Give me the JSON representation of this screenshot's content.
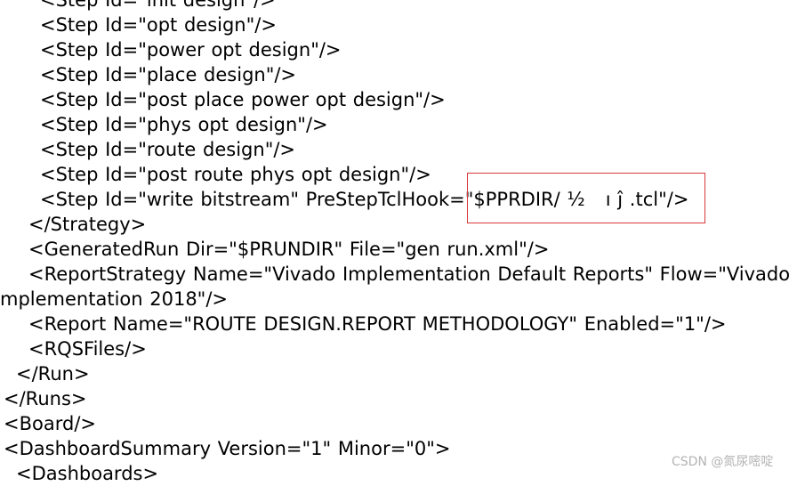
{
  "editor": {
    "lines": [
      "<Step Id=\"init design\"/>",
      "<Step Id=\"opt design\"/>",
      "<Step Id=\"power opt design\"/>",
      "<Step Id=\"place design\"/>",
      "<Step Id=\"post place power opt design\"/>",
      "<Step Id=\"phys opt design\"/>",
      "<Step Id=\"route design\"/>",
      "<Step Id=\"post route phys opt design\"/>",
      "<Step Id=\"write bitstream\" PreStepTclHook=\"$PPRDIR/ ½   ı ĵ .tcl\"/>",
      "</Strategy>",
      "<GeneratedRun Dir=\"$PRUNDIR\" File=\"gen run.xml\"/>",
      "<ReportStrategy Name=\"Vivado Implementation Default Reports\" Flow=\"Vivado",
      "mplementation 2018\"/>",
      "<Report Name=\"ROUTE DESIGN.REPORT METHODOLOGY\" Enabled=\"1\"/>",
      "<RQSFiles/>",
      "</Run>",
      "</Runs>",
      "<Board/>",
      "<DashboardSummary Version=\"1\" Minor=\"0\">",
      "<Dashboards>"
    ]
  },
  "watermark": "CSDN @氮尿嘧啶",
  "colors": {
    "text": "#000000",
    "highlight_border": "#d9383a",
    "background": "#ffffff"
  }
}
